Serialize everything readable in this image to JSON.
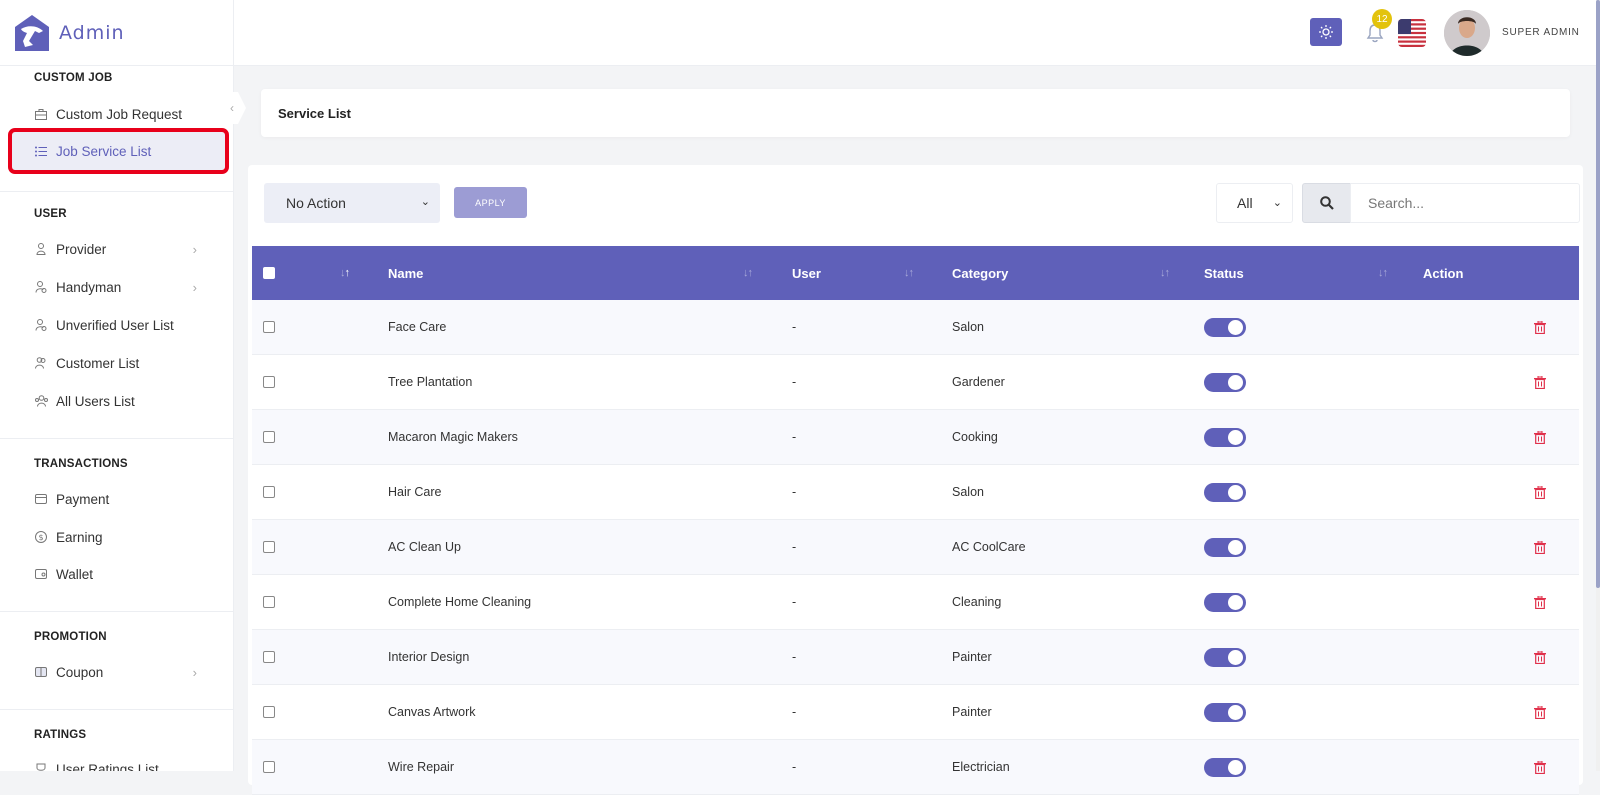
{
  "brand": {
    "name": "Admin"
  },
  "sidebar": {
    "sections": [
      {
        "title": "CUSTOM JOB",
        "items": [
          {
            "label": "Custom Job Request",
            "icon": "briefcase-icon",
            "has_submenu": false
          },
          {
            "label": "Job Service List",
            "icon": "list-icon",
            "has_submenu": false,
            "active": true
          }
        ]
      },
      {
        "title": "USER",
        "items": [
          {
            "label": "Provider",
            "icon": "user-icon",
            "has_submenu": true
          },
          {
            "label": "Handyman",
            "icon": "user-gear-icon",
            "has_submenu": true
          },
          {
            "label": "Unverified User List",
            "icon": "user-unverified-icon",
            "has_submenu": false
          },
          {
            "label": "Customer List",
            "icon": "users-icon",
            "has_submenu": false
          },
          {
            "label": "All Users List",
            "icon": "user-group-icon",
            "has_submenu": false
          }
        ]
      },
      {
        "title": "TRANSACTIONS",
        "items": [
          {
            "label": "Payment",
            "icon": "credit-card-icon",
            "has_submenu": false
          },
          {
            "label": "Earning",
            "icon": "dollar-circle-icon",
            "has_submenu": false
          },
          {
            "label": "Wallet",
            "icon": "wallet-icon",
            "has_submenu": false
          }
        ]
      },
      {
        "title": "PROMOTION",
        "items": [
          {
            "label": "Coupon",
            "icon": "ticket-icon",
            "has_submenu": true
          }
        ]
      },
      {
        "title": "RATINGS",
        "items": [
          {
            "label": "User Ratings List",
            "icon": "trophy-icon",
            "has_submenu": false
          }
        ]
      }
    ]
  },
  "header": {
    "notification_count": "12",
    "user_name": "SUPER ADMIN",
    "language": "en-US"
  },
  "page": {
    "title": "Service List"
  },
  "toolbar": {
    "bulk_action_value": "No Action",
    "apply_label": "APPLY",
    "filter_value": "All",
    "search_placeholder": "Search..."
  },
  "table": {
    "columns": [
      "",
      "Name",
      "User",
      "Category",
      "Status",
      "Action"
    ],
    "rows": [
      {
        "name": "Face Care",
        "user": "-",
        "category": "Salon",
        "status": true
      },
      {
        "name": "Tree Plantation",
        "user": "-",
        "category": "Gardener",
        "status": true
      },
      {
        "name": "Macaron Magic Makers",
        "user": "-",
        "category": "Cooking",
        "status": true
      },
      {
        "name": "Hair Care",
        "user": "-",
        "category": "Salon",
        "status": true
      },
      {
        "name": "AC Clean Up",
        "user": "-",
        "category": "AC CoolCare",
        "status": true
      },
      {
        "name": "Complete Home Cleaning",
        "user": "-",
        "category": "Cleaning",
        "status": true
      },
      {
        "name": "Interior Design",
        "user": "-",
        "category": "Painter",
        "status": true
      },
      {
        "name": "Canvas Artwork",
        "user": "-",
        "category": "Painter",
        "status": true
      },
      {
        "name": "Wire Repair",
        "user": "-",
        "category": "Electrician",
        "status": true
      }
    ]
  },
  "colors": {
    "accent": "#5f60b9",
    "danger": "#e0304a",
    "badge": "#e3c30d",
    "highlight": "#e8001b"
  }
}
